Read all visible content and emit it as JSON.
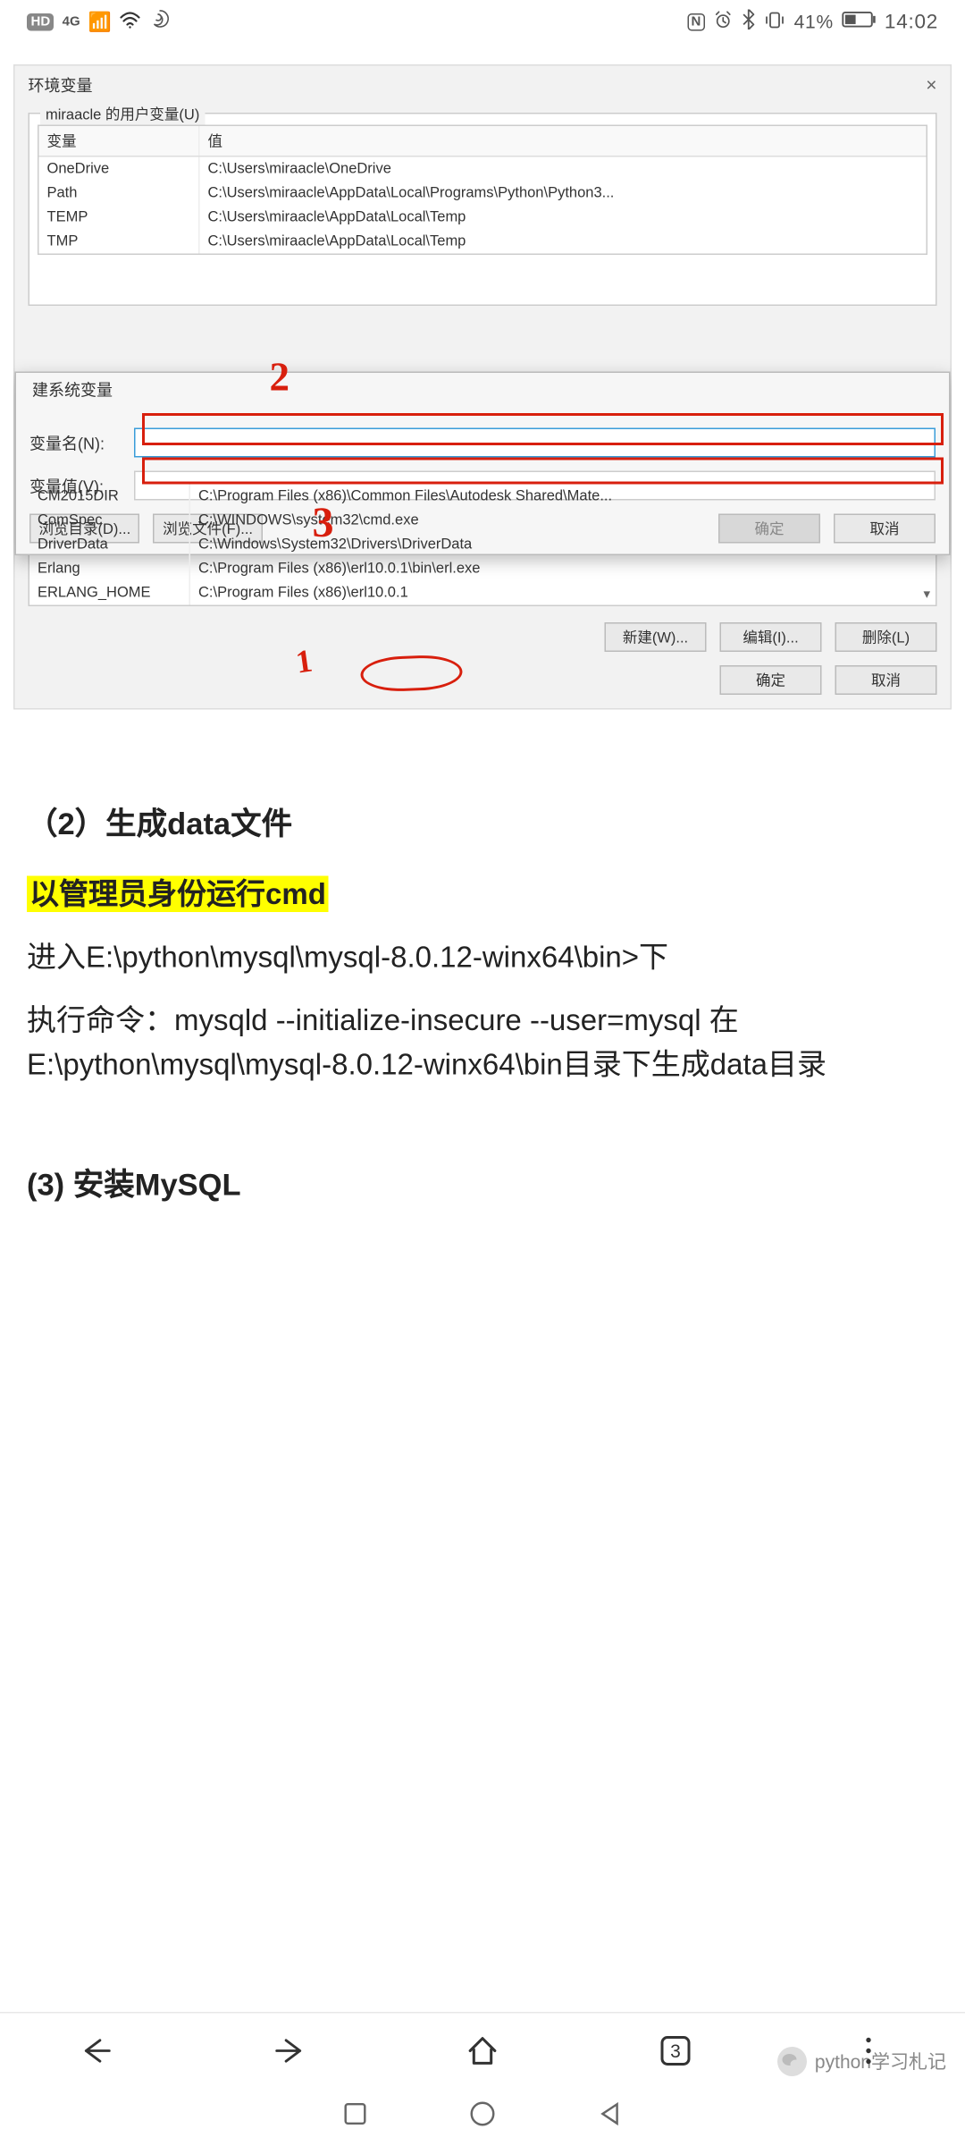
{
  "status": {
    "hd": "HD",
    "net": "4G",
    "right_text": "41%",
    "time": "14:02"
  },
  "dialog": {
    "title": "环境变量",
    "close": "×",
    "user_vars_group": "miraacle 的用户变量(U)",
    "col_name": "变量",
    "col_value": "值",
    "user_vars": [
      {
        "name": "OneDrive",
        "value": "C:\\Users\\miraacle\\OneDrive"
      },
      {
        "name": "Path",
        "value": "C:\\Users\\miraacle\\AppData\\Local\\Programs\\Python\\Python3..."
      },
      {
        "name": "TEMP",
        "value": "C:\\Users\\miraacle\\AppData\\Local\\Temp"
      },
      {
        "name": "TMP",
        "value": "C:\\Users\\miraacle\\AppData\\Local\\Temp"
      }
    ],
    "new_var_dialog": {
      "title": "建系统变量",
      "name_label": "变量名(N):",
      "value_label": "变量值(V):",
      "browse_dir": "浏览目录(D)...",
      "browse_file": "浏览文件(F)...",
      "ok": "确定",
      "cancel": "取消"
    },
    "sys_vars": [
      {
        "name": "CM2015DIR",
        "value": "C:\\Program Files (x86)\\Common Files\\Autodesk Shared\\Mate..."
      },
      {
        "name": "ComSpec",
        "value": "C:\\WINDOWS\\system32\\cmd.exe"
      },
      {
        "name": "DriverData",
        "value": "C:\\Windows\\System32\\Drivers\\DriverData"
      },
      {
        "name": "Erlang",
        "value": "C:\\Program Files (x86)\\erl10.0.1\\bin\\erl.exe"
      },
      {
        "name": "ERLANG_HOME",
        "value": "C:\\Program Files (x86)\\erl10.0.1"
      }
    ],
    "sys_buttons": {
      "new": "新建(W)...",
      "edit": "编辑(I)...",
      "delete": "删除(L)"
    },
    "dlg_buttons": {
      "ok": "确定",
      "cancel": "取消"
    }
  },
  "annotations": {
    "one": "1",
    "two": "2",
    "three": "3"
  },
  "article": {
    "sec2_title": "（2）生成data文件",
    "highlight": "以管理员身份运行cmd",
    "p1": "进入E:\\python\\mysql\\mysql-8.0.12-winx64\\bin>下",
    "p2": "执行命令：mysqld --initialize-insecure --user=mysql  在E:\\python\\mysql\\mysql-8.0.12-winx64\\bin目录下生成data目录",
    "sec3_title": "(3) 安装MySQL"
  },
  "browser": {
    "tab_count": "3"
  },
  "watermark": "python学习札记"
}
